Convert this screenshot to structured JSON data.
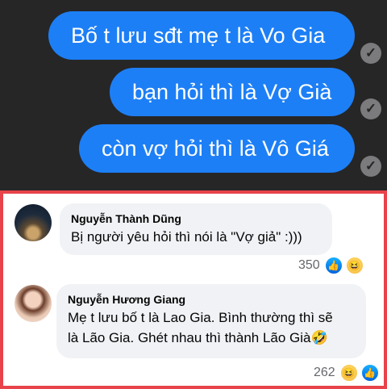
{
  "chat": {
    "messages": [
      "Bố t lưu sđt mẹ t là Vo Gia",
      "bạn hỏi thì là Vợ Già",
      "còn vợ hỏi thì là Vô Giá"
    ],
    "status_icon": "seen-check-icon"
  },
  "comments": [
    {
      "author": "Nguyễn Thành Dũng",
      "text": "Bị người yêu hỏi thì nói là \"Vợ giả\" :)))",
      "reaction_count": "350",
      "reactions": [
        "like-icon",
        "haha-icon"
      ]
    },
    {
      "author": "Nguyễn Hương Giang",
      "text_line1": "Mẹ t lưu bố t là Lao Gia. Bình thường thì sẽ",
      "text_line2": "là Lão Gia. Ghét nhau thì thành Lão Già🤣",
      "reaction_count": "262",
      "reactions": [
        "haha-icon",
        "like-icon"
      ]
    }
  ],
  "colors": {
    "chat_background": "#262627",
    "bubble_blue": "#1d7ff6",
    "highlight_border": "#e8434a",
    "comment_bubble": "#f0f2f5"
  }
}
